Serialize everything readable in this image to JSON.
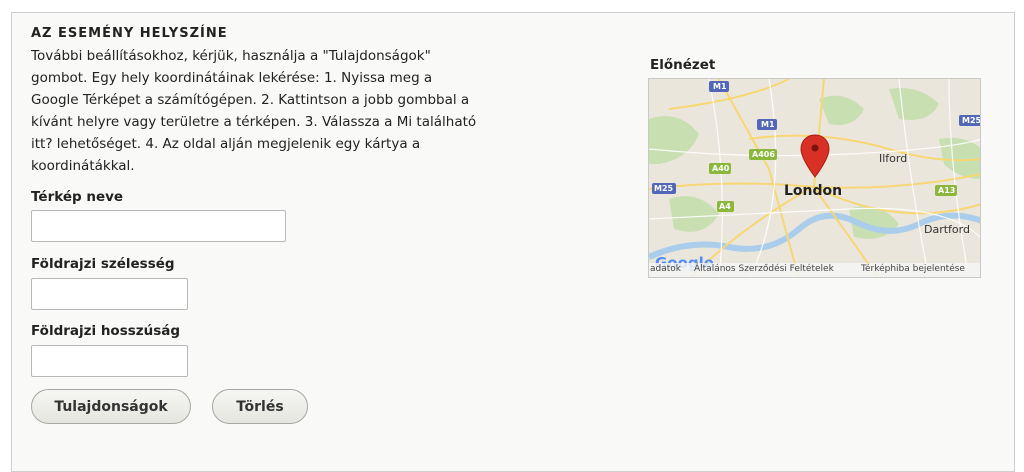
{
  "section": {
    "title": "AZ ESEMÉNY HELYSZÍNE",
    "description": "További beállításokhoz, kérjük, használja a \"Tulajdonságok\" gombot. Egy hely koordinátáinak lekérése: 1. Nyissa meg a Google Térképet a számítógépen. 2. Kattintson a jobb gombbal a kívánt helyre vagy területre a térképen. 3. Válassza a Mi található itt? lehetőséget. 4. Az oldal alján megjelenik egy kártya a koordinátákkal."
  },
  "fields": {
    "map_name": {
      "label": "Térkép neve",
      "value": ""
    },
    "latitude": {
      "label": "Földrajzi szélesség",
      "value": ""
    },
    "longitude": {
      "label": "Földrajzi hosszúság",
      "value": ""
    }
  },
  "buttons": {
    "properties": "Tulajdonságok",
    "delete": "Törlés"
  },
  "preview": {
    "label": "Előnézet",
    "map": {
      "city_label": "London",
      "place_labels": [
        "Ilford",
        "Dartford"
      ],
      "road_labels": [
        "M1",
        "M1",
        "M25",
        "A406",
        "A40",
        "M25",
        "A13",
        "A4"
      ],
      "logo_text": "Google",
      "footer": {
        "data": "adatok",
        "terms": "Általános Szerződési Feltételek",
        "report": "Térképhiba bejelentése"
      },
      "colors": {
        "marker": "#d93025",
        "water": "#a9cdea",
        "park": "#c8dfb2",
        "motorway_badge": "#5267b7",
        "a_road_badge": "#8bb73d"
      }
    }
  }
}
